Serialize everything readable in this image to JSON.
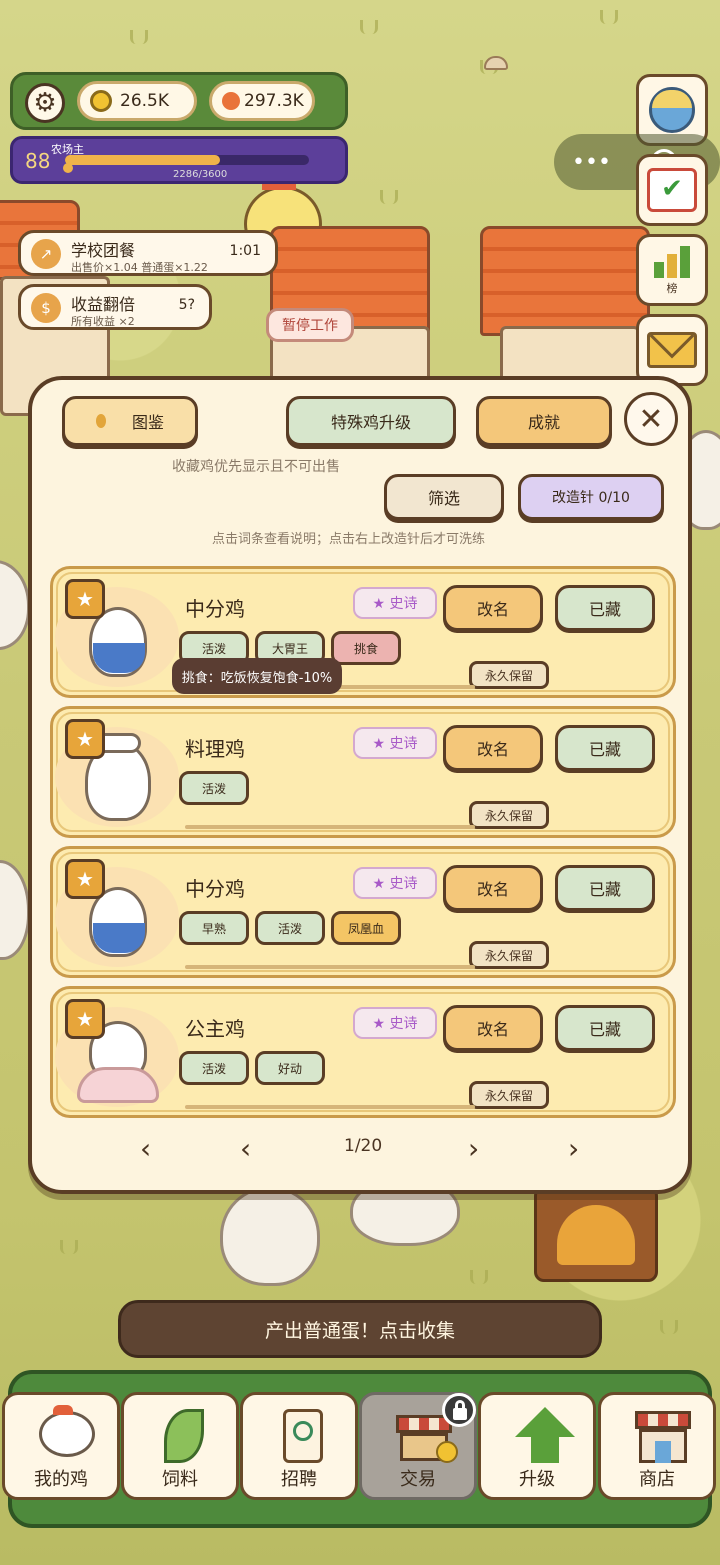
{
  "hud": {
    "gold": "26.5K",
    "gems": "297.3K",
    "level": "88",
    "title": "农场主",
    "exp": "2286/3600",
    "exp_progress": 0.635
  },
  "right_icons": {
    "rank_label": "榜"
  },
  "buffs": [
    {
      "title": "学校团餐",
      "sub": "出售价×1.04 普通蛋×1.22",
      "right": "1:01"
    },
    {
      "title": "收益翻倍",
      "sub": "所有收益 ×2",
      "right": "5?"
    }
  ],
  "scene": {
    "work_sign": "暂停工作"
  },
  "modal": {
    "tab_book": "图鉴",
    "tab_special": "特殊鸡升级",
    "tab_achieve": "成就",
    "close": "✕",
    "collect_hint": "收藏鸡优先显示且不可出售",
    "filter": "筛选",
    "needle": "改造针 0/10",
    "needle_hint": "点击词条查看说明；点击右上改造针后才可洗练",
    "cards": [
      {
        "name": "中分鸡",
        "rarity": "★ 史诗",
        "rename": "改名",
        "stored": "已藏",
        "keep": "永久保留",
        "tags": [
          "活泼",
          "大胃王",
          "挑食"
        ]
      },
      {
        "name": "料理鸡",
        "rarity": "★ 史诗",
        "rename": "改名",
        "stored": "已藏",
        "keep": "永久保留",
        "tags": [
          "活泼"
        ]
      },
      {
        "name": "中分鸡",
        "rarity": "★ 史诗",
        "rename": "改名",
        "stored": "已藏",
        "keep": "永久保留",
        "tags": [
          "早熟",
          "活泼",
          "凤凰血"
        ]
      },
      {
        "name": "公主鸡",
        "rarity": "★ 史诗",
        "rename": "改名",
        "stored": "已藏",
        "keep": "永久保留",
        "tags": [
          "活泼",
          "好动"
        ]
      }
    ],
    "tooltip": "挑食：吃饭恢复饱食-10%",
    "page": "1/20",
    "first": "‹",
    "prev": "‹",
    "next": "›",
    "last": "›"
  },
  "banner": "产出普通蛋！点击收集",
  "nav": [
    {
      "label": "我的鸡"
    },
    {
      "label": "饲料"
    },
    {
      "label": "招聘"
    },
    {
      "label": "交易"
    },
    {
      "label": "升级"
    },
    {
      "label": "商店"
    }
  ],
  "colors": {
    "accent_green": "#5a8a3a",
    "level_purple": "#5c3f9a",
    "card_bg": "#fdebb0",
    "button_orange": "#f4c77a",
    "button_green": "#d7e6cc"
  }
}
